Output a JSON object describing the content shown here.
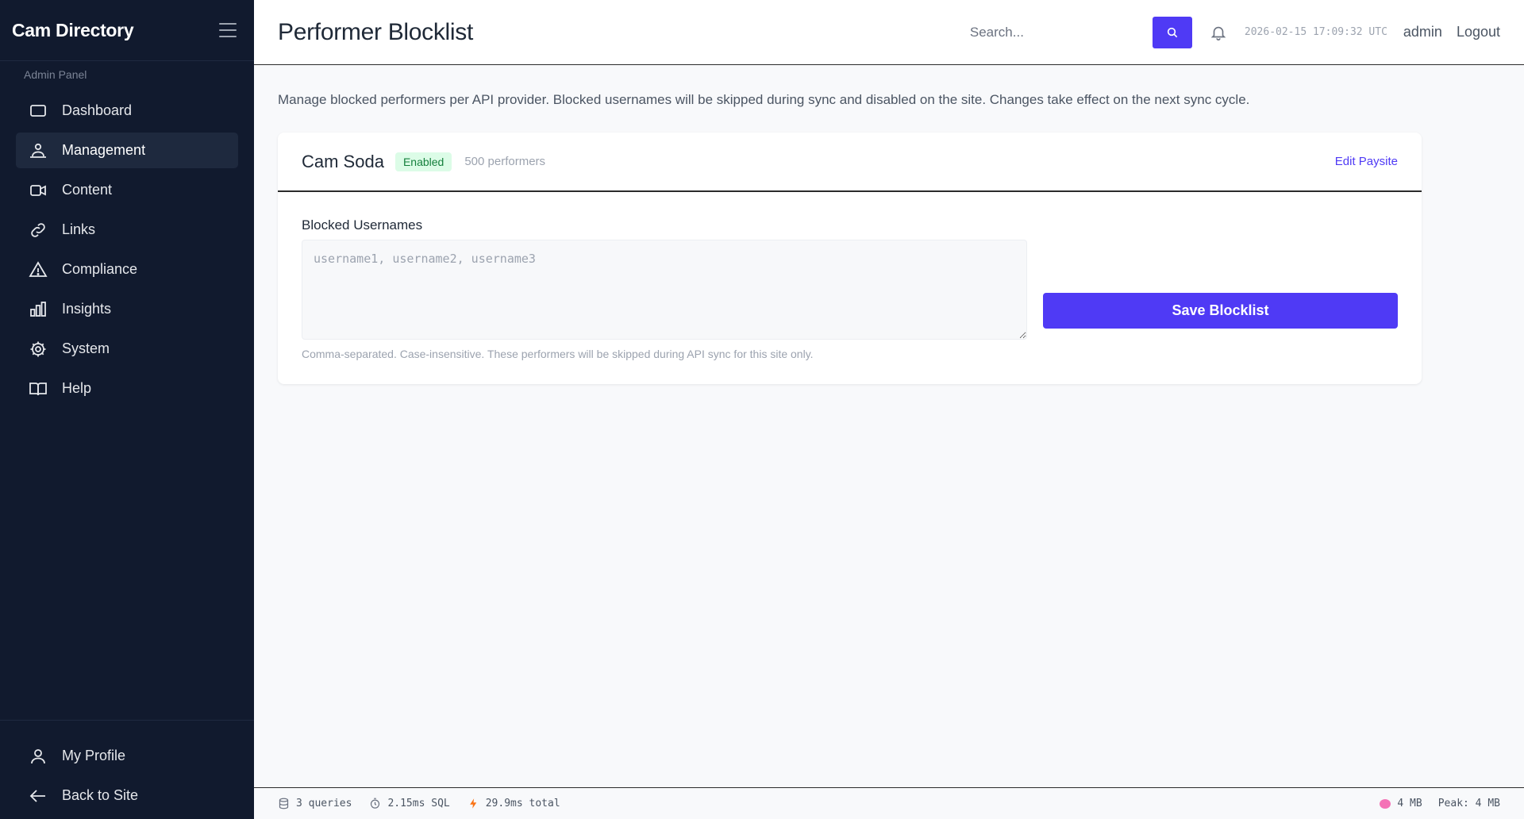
{
  "sidebar": {
    "brand": "Cam Directory",
    "panel_label": "Admin Panel",
    "items": [
      {
        "label": "Dashboard",
        "icon": "monitor-icon"
      },
      {
        "label": "Management",
        "icon": "users-icon"
      },
      {
        "label": "Content",
        "icon": "video-icon"
      },
      {
        "label": "Links",
        "icon": "link-icon"
      },
      {
        "label": "Compliance",
        "icon": "warning-icon"
      },
      {
        "label": "Insights",
        "icon": "bar-chart-icon"
      },
      {
        "label": "System",
        "icon": "gear-icon"
      },
      {
        "label": "Help",
        "icon": "book-icon"
      }
    ],
    "active_index": 1,
    "bottom_items": [
      {
        "label": "My Profile",
        "icon": "user-icon"
      },
      {
        "label": "Back to Site",
        "icon": "arrow-left-icon"
      }
    ]
  },
  "header": {
    "title": "Performer Blocklist",
    "search_placeholder": "Search...",
    "datetime": "2026-02-15 17:09:32 UTC",
    "user": "admin",
    "logout": "Logout"
  },
  "main": {
    "intro": "Manage blocked performers per API provider. Blocked usernames will be skipped during sync and disabled on the site. Changes take effect on the next sync cycle.",
    "card": {
      "title": "Cam Soda",
      "status": "Enabled",
      "count": "500 performers",
      "edit_link": "Edit Paysite",
      "field_label": "Blocked Usernames",
      "textarea_value": "",
      "textarea_placeholder": "username1, username2, username3",
      "hint": "Comma-separated. Case-insensitive. These performers will be skipped during API sync for this site only.",
      "save_label": "Save Blocklist"
    }
  },
  "footer": {
    "queries": "3 queries",
    "sql_time": "2.15ms SQL",
    "total_time": "29.9ms total",
    "memory": "4 MB",
    "peak": "Peak: 4 MB"
  },
  "colors": {
    "accent": "#4f3af5",
    "sidebar_bg": "#111a2e",
    "sidebar_active": "#1e293e",
    "badge_bg": "#dcfce7",
    "badge_text": "#15803d"
  }
}
